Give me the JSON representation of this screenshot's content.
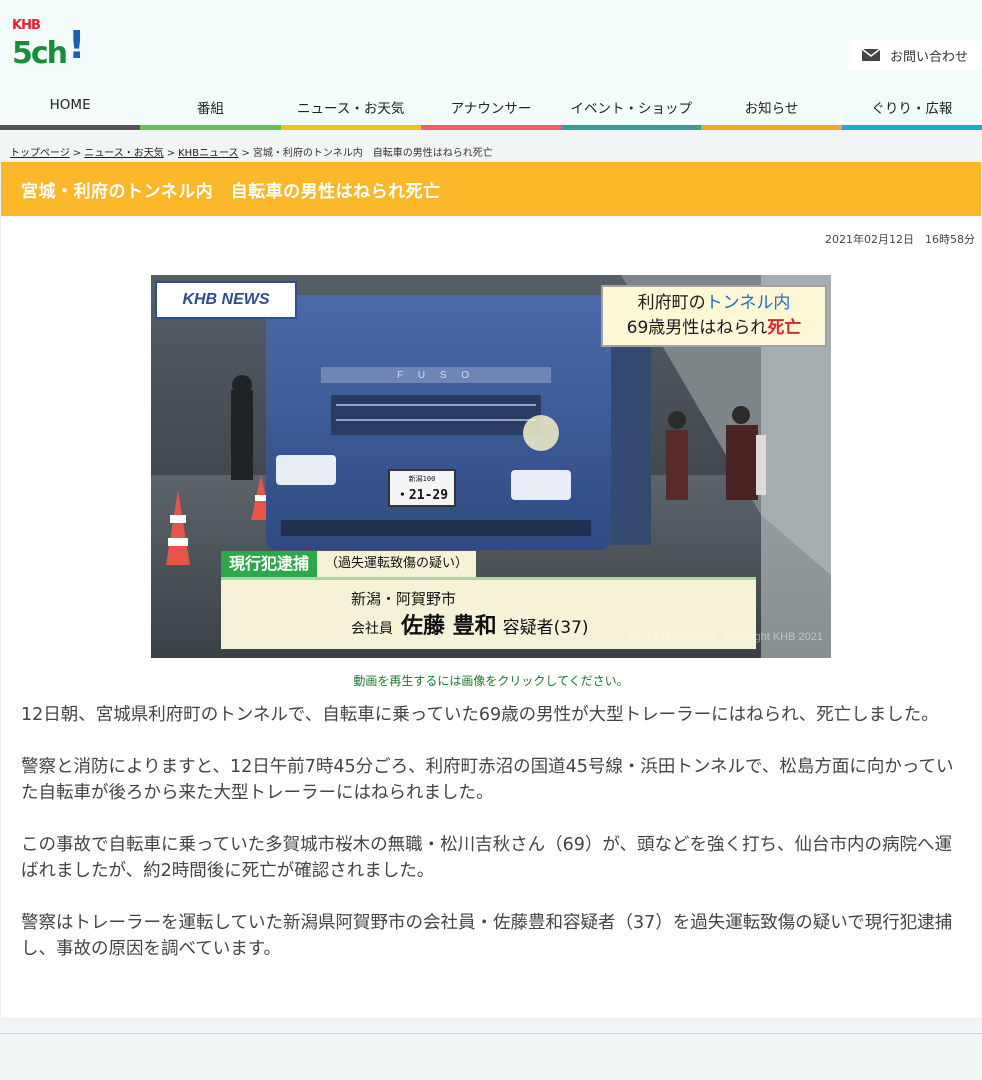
{
  "site": {
    "logo_top": "KHB",
    "logo_main": "5ch",
    "logo_mark": "!"
  },
  "header": {
    "contact_label": "お問い合わせ",
    "contact_icon": "mail-icon"
  },
  "nav": {
    "items": [
      {
        "label": "HOME",
        "color": "#555555"
      },
      {
        "label": "番組",
        "color": "#6cc04a"
      },
      {
        "label": "ニュース・お天気",
        "color": "#f4c21b"
      },
      {
        "label": "アナウンサー",
        "color": "#f0606a"
      },
      {
        "label": "イベント・ショップ",
        "color": "#2fa39a"
      },
      {
        "label": "お知らせ",
        "color": "#f5a623"
      },
      {
        "label": "ぐりり・広報",
        "color": "#1ea7d8"
      }
    ]
  },
  "breadcrumb": {
    "items": [
      "トップページ",
      "ニュース・お天気",
      "KHBニュース"
    ],
    "current": "宮城・利府のトンネル内　自転車の男性はねられ死亡",
    "separator": ">"
  },
  "article": {
    "title": "宮城・利府のトンネル内　自転車の男性はねられ死亡",
    "date": "2021年02月12日　16時58分",
    "caption": "動画を再生するには画像をクリックしてください。",
    "paragraphs": [
      "12日朝、宮城県利府町のトンネルで、自転車に乗っていた69歳の男性が大型トレーラーにはねられ、死亡しました。",
      "警察と消防によりますと、12日午前7時45分ごろ、利府町赤沼の国道45号線・浜田トンネルで、松島方面に向かっていた自転車が後ろから来た大型トレーラーにはねられました。",
      "この事故で自転車に乗っていた多賀城市桜木の無職・松川吉秋さん（69）が、頭などを強く打ち、仙台市内の病院へ運ばれましたが、約2時間後に死亡が確認されました。",
      "警察はトレーラーを運転していた新潟県阿賀野市の会社員・佐藤豊和容疑者（37）を過失運転致傷の疑いで現行犯逮捕し、事故の原因を調べています。"
    ]
  },
  "video": {
    "logo": "KHB NEWS",
    "headline_line1_a": "利府町の",
    "headline_line1_b": "トンネル内",
    "headline_line2_a": "69歳男性はねられ",
    "headline_line2_b": "死亡",
    "arrest_label": "現行犯逮捕",
    "arrest_note": "（過失運転致傷の疑い）",
    "place": "新潟・阿賀野市",
    "role": "会社員",
    "name": "佐藤 豊和",
    "suffix": "容疑者(37)",
    "plate_top": "新潟100",
    "plate_main": "・21-29",
    "truck_brand": "F U S O",
    "copyright": "All rights reserved. Copyright KHB 2021"
  }
}
